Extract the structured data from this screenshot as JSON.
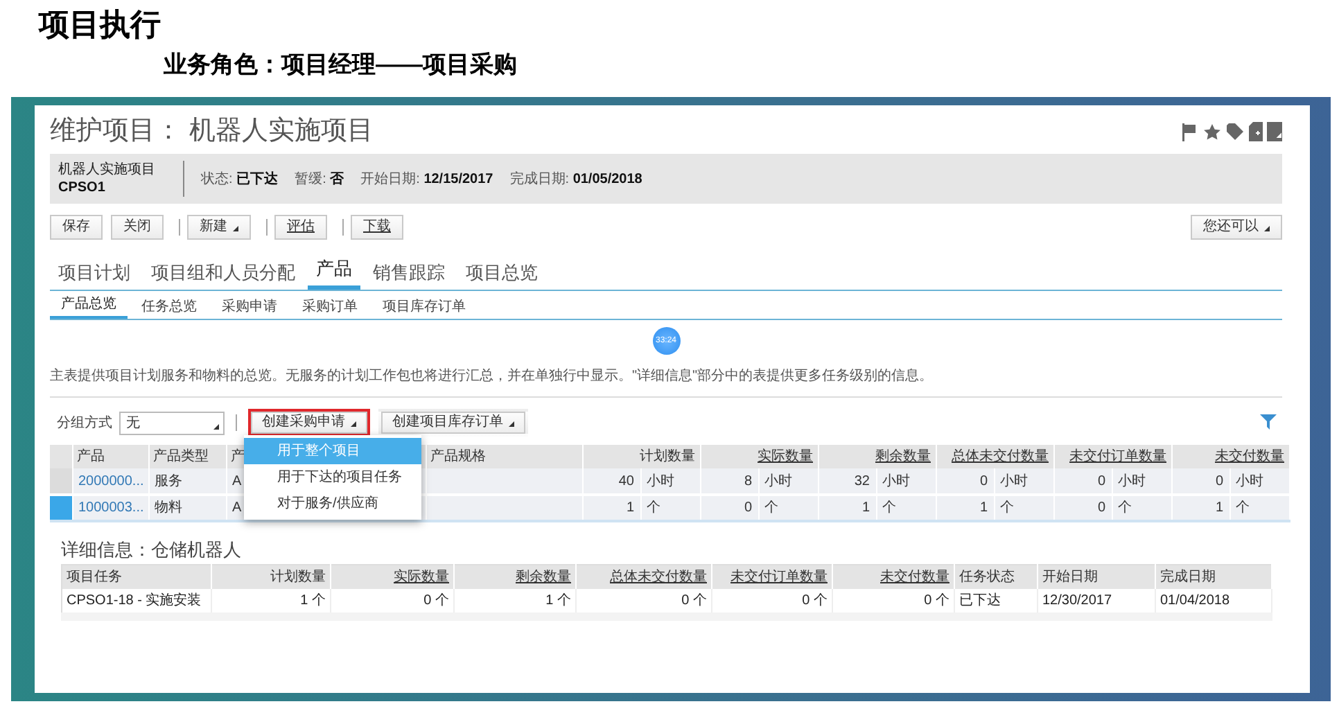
{
  "slide": {
    "title": "项目执行",
    "subtitle": "业务角色：项目经理——项目采购"
  },
  "window": {
    "title": "维护项目： 机器人实施项目"
  },
  "header": {
    "name": "机器人实施项目",
    "code": "CPSO1",
    "fields": [
      {
        "label": "状态:",
        "value": "已下达"
      },
      {
        "label": "暂缓:",
        "value": "否"
      },
      {
        "label": "开始日期:",
        "value": "12/15/2017"
      },
      {
        "label": "完成日期:",
        "value": "01/05/2018"
      }
    ]
  },
  "toolbar": {
    "items": [
      {
        "kind": "button",
        "label": "保存",
        "dropdown": false,
        "underlined": false
      },
      {
        "kind": "button",
        "label": "关闭",
        "dropdown": false,
        "underlined": false
      },
      {
        "kind": "separator"
      },
      {
        "kind": "button",
        "label": "新建",
        "dropdown": true,
        "underlined": false
      },
      {
        "kind": "separator"
      },
      {
        "kind": "button",
        "label": "评估",
        "dropdown": false,
        "underlined": true
      },
      {
        "kind": "separator"
      },
      {
        "kind": "button",
        "label": "下载",
        "dropdown": false,
        "underlined": true
      }
    ],
    "more": {
      "label": "您还可以",
      "dropdown": true
    }
  },
  "tabs": [
    {
      "label": "项目计划",
      "selected": false
    },
    {
      "label": "项目组和人员分配",
      "selected": false
    },
    {
      "label": "产品",
      "selected": true
    },
    {
      "label": "销售跟踪",
      "selected": false
    },
    {
      "label": "项目总览",
      "selected": false
    }
  ],
  "subtabs": [
    {
      "label": "产品总览",
      "selected": true
    },
    {
      "label": "任务总览",
      "selected": false
    },
    {
      "label": "采购申请",
      "selected": false
    },
    {
      "label": "采购订单",
      "selected": false
    },
    {
      "label": "项目库存订单",
      "selected": false
    }
  ],
  "timer": "33:24",
  "description": "主表提供项目计划服务和物料的总览。无服务的计划工作包也将进行汇总，并在单独行中显示。\"详细信息\"部分中的表提供更多任务级别的信息。",
  "group_by": {
    "label": "分组方式",
    "value": "无"
  },
  "actions": [
    {
      "label": "创建采购申请",
      "highlighted": true
    },
    {
      "label": "创建项目库存订单",
      "highlighted": false
    }
  ],
  "menu": {
    "items": [
      {
        "label": "用于整个项目",
        "selected": true
      },
      {
        "label": "用于下达的项目任务",
        "selected": false
      },
      {
        "label": "对于服务/供应商",
        "selected": false
      }
    ]
  },
  "table": {
    "columns": [
      {
        "kind": "text",
        "label": "产品",
        "linked": false
      },
      {
        "kind": "text",
        "label": "产品类型",
        "linked": false
      },
      {
        "kind": "text",
        "label": "产",
        "linked": false
      },
      {
        "kind": "text",
        "label": "产品规格",
        "linked": false
      },
      {
        "kind": "quantity",
        "label": "计划数量",
        "linked": false
      },
      {
        "kind": "quantity",
        "label": "实际数量",
        "linked": true
      },
      {
        "kind": "quantity",
        "label": "剩余数量",
        "linked": true
      },
      {
        "kind": "quantity",
        "label": "总体未交付数量",
        "linked": true
      },
      {
        "kind": "quantity",
        "label": "未交付订单数量",
        "linked": true
      },
      {
        "kind": "quantity",
        "label": "未交付数量",
        "linked": true
      }
    ],
    "rows": [
      {
        "selected": false,
        "texts": [
          "2000000...",
          "服务",
          "A"
        ],
        "quantities": [
          {
            "value": "40",
            "unit": "小时"
          },
          {
            "value": "8",
            "unit": "小时"
          },
          {
            "value": "32",
            "unit": "小时"
          },
          {
            "value": "0",
            "unit": "小时"
          },
          {
            "value": "0",
            "unit": "小时"
          },
          {
            "value": "0",
            "unit": "小时"
          }
        ]
      },
      {
        "selected": true,
        "texts": [
          "1000003...",
          "物料",
          "A"
        ],
        "quantities": [
          {
            "value": "1",
            "unit": "个"
          },
          {
            "value": "0",
            "unit": "个"
          },
          {
            "value": "1",
            "unit": "个"
          },
          {
            "value": "1",
            "unit": "个"
          },
          {
            "value": "0",
            "unit": "个"
          },
          {
            "value": "1",
            "unit": "个"
          }
        ]
      }
    ]
  },
  "detail": {
    "title": "详细信息：仓储机器人",
    "columns": [
      {
        "kind": "text",
        "label": "项目任务",
        "linked": false
      },
      {
        "kind": "quantity",
        "label": "计划数量",
        "linked": false
      },
      {
        "kind": "quantity",
        "label": "实际数量",
        "linked": true
      },
      {
        "kind": "quantity",
        "label": "剩余数量",
        "linked": true
      },
      {
        "kind": "quantity",
        "label": "总体未交付数量",
        "linked": true
      },
      {
        "kind": "quantity",
        "label": "未交付订单数量",
        "linked": true
      },
      {
        "kind": "quantity",
        "label": "未交付数量",
        "linked": true
      },
      {
        "kind": "text",
        "label": "任务状态",
        "linked": false
      },
      {
        "kind": "text",
        "label": "开始日期",
        "linked": false
      },
      {
        "kind": "text",
        "label": "完成日期",
        "linked": false
      }
    ],
    "rows": [
      {
        "cells": [
          "CPSO1-18 - 实施安装",
          "1 个",
          "0 个",
          "1 个",
          "0 个",
          "0 个",
          "0 个",
          "已下达",
          "12/30/2017",
          "01/04/2018"
        ]
      }
    ]
  }
}
